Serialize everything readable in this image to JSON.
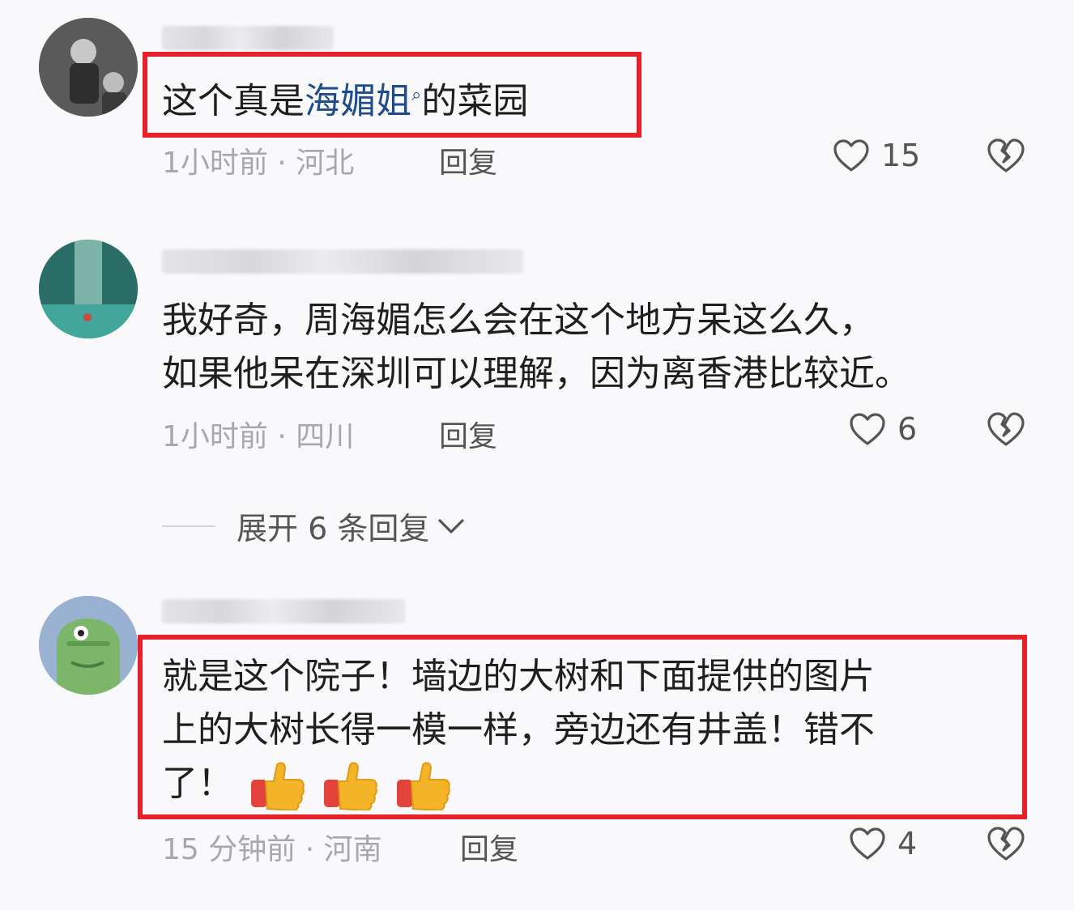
{
  "comments": [
    {
      "text_before": "这个真是",
      "text_link": "海媚姐",
      "text_after": "的菜园",
      "meta": "1小时前 · 河北",
      "reply_label": "回复",
      "likes": "15"
    },
    {
      "line1": "我好奇，周海媚怎么会在这个地方呆这么久，",
      "line2": "如果他呆在深圳可以理解，因为离香港比较近。",
      "meta": "1小时前 · 四川",
      "reply_label": "回复",
      "likes": "6"
    },
    {
      "line1": "就是这个院子！墙边的大树和下面提供的图片",
      "line2": "上的大树长得一模一样，旁边还有井盖！错不",
      "line3": "了！",
      "meta": "15 分钟前 · 河南",
      "reply_label": "回复",
      "likes": "4"
    }
  ],
  "expand_replies": "展开 6 条回复",
  "icons": {
    "like": "heart-outline-icon",
    "dislike": "broken-heart-icon",
    "chevron": "chevron-down-icon",
    "thumb": "thumbs-up-emoji",
    "search_mark": "search-icon"
  },
  "colors": {
    "highlight_box": "#e8202a",
    "link": "#1e4b8c",
    "meta": "#a7a7ad"
  }
}
